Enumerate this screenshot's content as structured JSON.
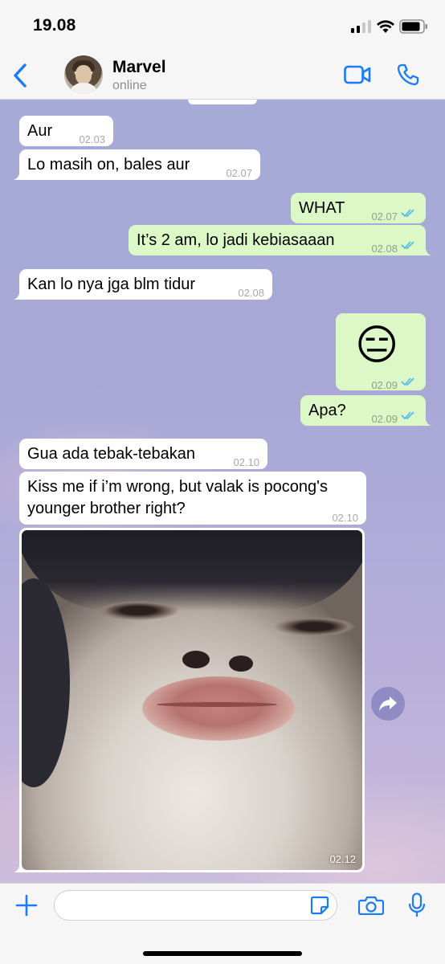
{
  "status_bar": {
    "time": "19.08",
    "icons": [
      "signal-icon",
      "wifi-icon",
      "battery-icon"
    ]
  },
  "header": {
    "contact_name": "Marvel",
    "contact_status": "online",
    "accent_color": "#1a7cf5",
    "icons": [
      "back-chevron-icon",
      "video-call-icon",
      "phone-call-icon"
    ]
  },
  "messages": [
    {
      "direction": "in",
      "text": "Aur",
      "time": "02.03"
    },
    {
      "direction": "in",
      "text": "Lo masih on, bales aur",
      "time": "02.07"
    },
    {
      "direction": "out",
      "text": "WHAT",
      "time": "02.07",
      "read": true
    },
    {
      "direction": "out",
      "text": "It’s 2 am, lo jadi kebiasaaan",
      "time": "02.08",
      "read": true
    },
    {
      "direction": "in",
      "text": "Kan lo nya jga blm tidur",
      "time": "02.08"
    },
    {
      "direction": "out",
      "text": "😑",
      "time": "02.09",
      "read": true
    },
    {
      "direction": "out",
      "text": "Apa?",
      "time": "02.09",
      "read": true
    },
    {
      "direction": "in",
      "text": "Gua ada tebak-tebakan",
      "time": "02.10"
    },
    {
      "direction": "in",
      "text_line1": "Kiss me if i’m wrong, but valak is pocong's",
      "text_line2": "younger brother right?",
      "time": "02.10"
    },
    {
      "direction": "in",
      "type": "photo",
      "time": "02.12"
    }
  ],
  "composer": {
    "icons": [
      "plus-icon",
      "sticker-icon",
      "camera-icon",
      "microphone-icon"
    ]
  },
  "colors": {
    "incoming_bubble": "#ffffff",
    "outgoing_bubble": "#dcf8c6",
    "read_ticks": "#4fb6ec"
  }
}
